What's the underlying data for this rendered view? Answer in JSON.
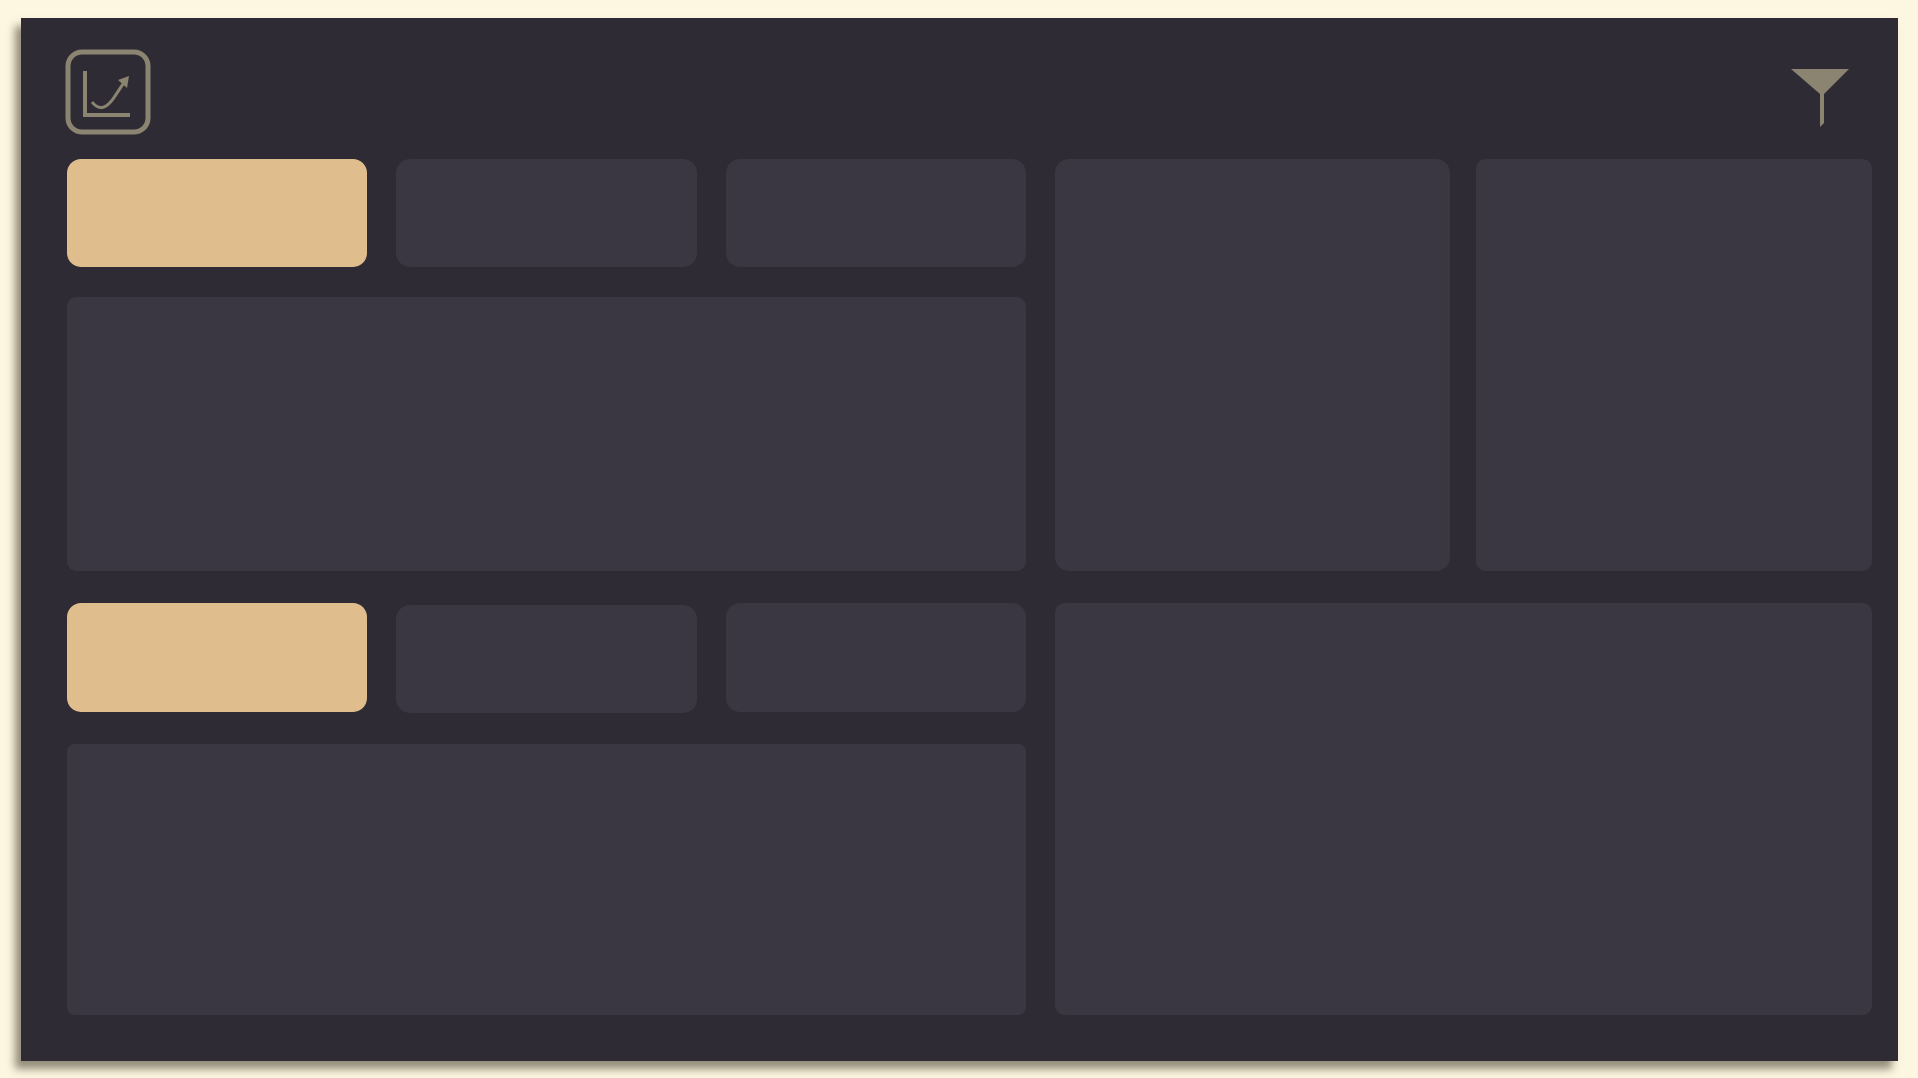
{
  "colors": {
    "background": "#fdf6e0",
    "panel": "#2e2b35",
    "card": "#3a3742",
    "accent": "#e0bd8c",
    "icon": "#8a8470"
  },
  "icons": {
    "logo": "chart-trend-icon",
    "filter": "filter-icon"
  },
  "tiles": [
    {
      "name": "tile-1",
      "selected": true
    },
    {
      "name": "tile-2",
      "selected": false
    },
    {
      "name": "tile-3",
      "selected": false
    },
    {
      "name": "tile-4",
      "selected": true
    },
    {
      "name": "tile-5",
      "selected": false
    },
    {
      "name": "tile-6",
      "selected": false
    }
  ]
}
